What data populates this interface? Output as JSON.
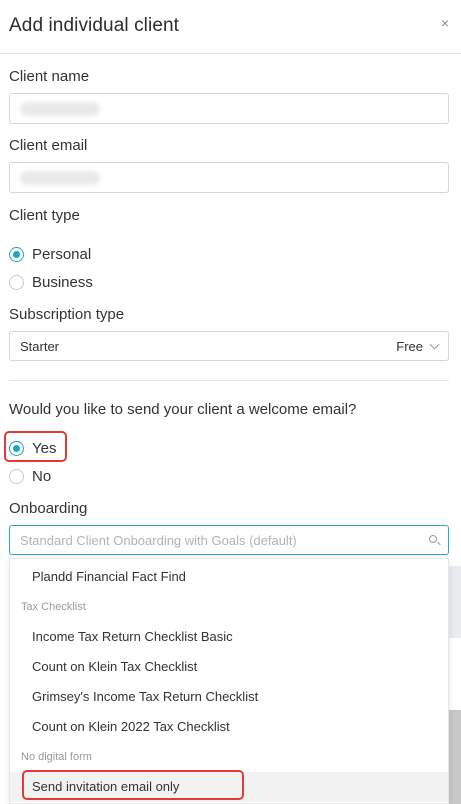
{
  "dialog": {
    "title": "Add individual client",
    "close_glyph": "×"
  },
  "client_name": {
    "label": "Client name"
  },
  "client_email": {
    "label": "Client email"
  },
  "client_type": {
    "label": "Client type",
    "options": [
      "Personal",
      "Business"
    ],
    "selected": "Personal"
  },
  "subscription_type": {
    "label": "Subscription type",
    "value": "Starter",
    "price": "Free"
  },
  "welcome_email": {
    "question": "Would you like to send your client a welcome email?",
    "options": [
      "Yes",
      "No"
    ],
    "selected": "Yes"
  },
  "onboarding": {
    "label": "Onboarding",
    "placeholder": "Standard Client Onboarding with Goals (default)",
    "items": [
      {
        "type": "option",
        "label": "Plandd Financial Fact Find"
      },
      {
        "type": "group",
        "label": "Tax Checklist"
      },
      {
        "type": "option",
        "label": "Income Tax Return Checklist Basic"
      },
      {
        "type": "option",
        "label": "Count on Klein Tax Checklist"
      },
      {
        "type": "option",
        "label": "Grimsey's Income Tax Return Checklist"
      },
      {
        "type": "option",
        "label": "Count on Klein 2022 Tax Checklist"
      },
      {
        "type": "group",
        "label": "No digital form"
      },
      {
        "type": "option",
        "label": "Send invitation email only",
        "active": true
      }
    ]
  },
  "colors": {
    "accent": "#1aa5c2",
    "highlight": "#e53935"
  }
}
